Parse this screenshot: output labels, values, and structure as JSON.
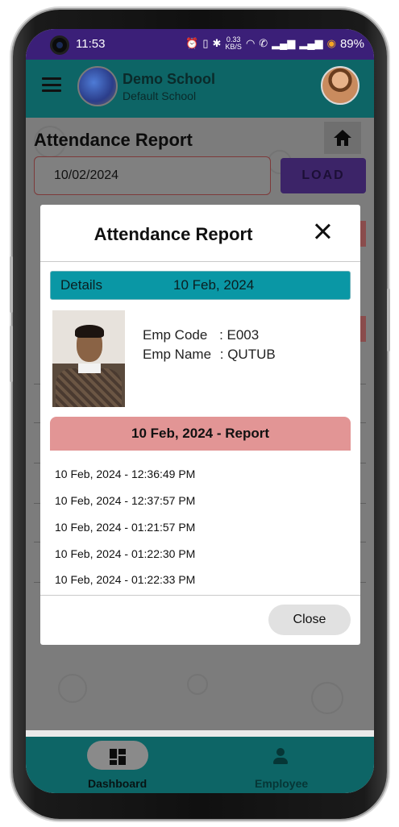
{
  "status_bar": {
    "time": "11:53",
    "net_speed": "0.33\nKB/S",
    "battery": "89%"
  },
  "app_bar": {
    "school_name": "Demo School",
    "school_subtitle": "Default School"
  },
  "page": {
    "title": "Attendance Report",
    "date_value": "10/02/2024",
    "load_label": "LOAD"
  },
  "dialog": {
    "title": "Attendance Report",
    "details_label": "Details",
    "details_date": "10 Feb, 2024",
    "emp_code_label": "Emp Code",
    "emp_code_value": ": E003",
    "emp_name_label": "Emp Name",
    "emp_name_value": ": QUTUB",
    "report_title": "10 Feb, 2024 - Report",
    "entries": [
      "10 Feb, 2024 - 12:36:49 PM",
      "10 Feb, 2024 - 12:37:57 PM",
      "10 Feb, 2024 - 01:21:57 PM",
      "10 Feb, 2024 - 01:22:30 PM",
      "10 Feb, 2024 - 01:22:33 PM"
    ],
    "close_label": "Close"
  },
  "bottom_nav": {
    "dashboard_label": "Dashboard",
    "employee_label": "Employee"
  },
  "colors": {
    "status_bar": "#3b1f78",
    "app_bar": "#0d6566",
    "details_bar": "#0a97a5",
    "report_header": "#e29595"
  }
}
